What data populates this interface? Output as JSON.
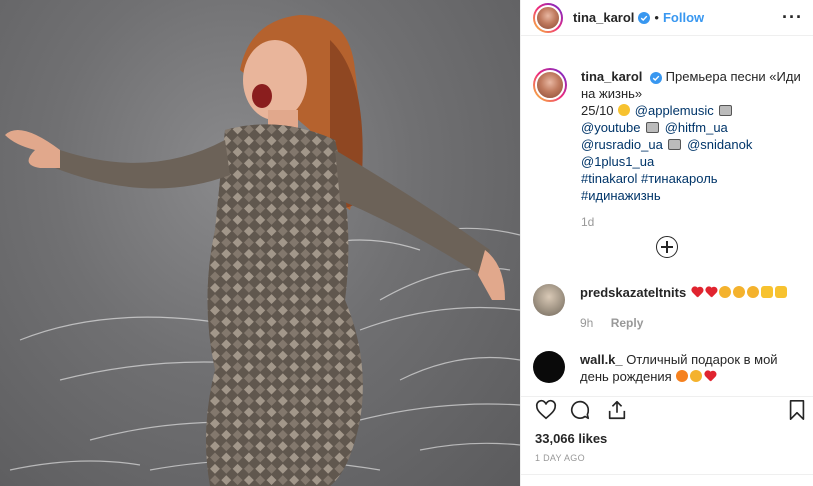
{
  "post": {
    "username": "tina_karol",
    "follow_label": "Follow",
    "dot": "•",
    "more_label": "···"
  },
  "caption": {
    "username": "tina_karol",
    "text_line1": "Премьера песни «Иди",
    "text_line2": "на жизнь»",
    "date_prefix": "25/10",
    "mention_applemusic": "@applemusic",
    "mention_youtube": "@youtube",
    "mention_hitfm": "@hitfm_ua",
    "mention_rusradio": "@rusradio_ua",
    "mention_snidanok": "@snidanok",
    "mention_1plus1": "@1plus1_ua",
    "hashtags_line1": "#tinakarol #тинакароль",
    "hashtags_line2": "#идинажизнь",
    "time": "1d"
  },
  "comments": [
    {
      "username": "predskazateltnits",
      "time": "9h",
      "reply_label": "Reply"
    },
    {
      "username": "wall.k_",
      "text_line1": "Отличный подарок в мой",
      "text_line2": "день рождения"
    }
  ],
  "stats": {
    "likes": "33,066 likes",
    "posted": "1 DAY AGO"
  },
  "colors": {
    "link": "#003569",
    "follow": "#3897f0",
    "muted": "#999999",
    "verified": "#3897f0"
  },
  "icons": {
    "header_avatar": "avatar-icon",
    "verified": "verified-badge-icon",
    "more": "more-options-icon",
    "load_more": "plus-circle-icon",
    "like": "heart-outline-icon",
    "comment": "comment-bubble-icon",
    "share": "share-icon",
    "save": "bookmark-icon"
  }
}
